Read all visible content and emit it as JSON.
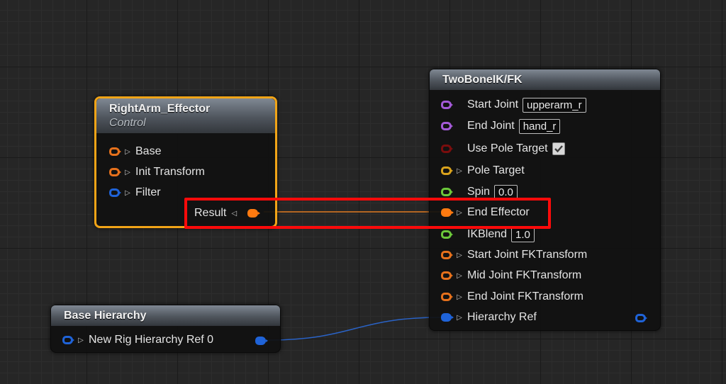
{
  "colors": {
    "accent_selected": "#f1a417",
    "highlight": "#ff0a0a",
    "wire_transform": "#e07a20",
    "wire_hierarchy": "#2a63c7"
  },
  "nodes": {
    "right_arm_effector": {
      "title": "RightArm_Effector",
      "subtitle": "Control",
      "pins": {
        "base": {
          "label": "Base",
          "color": "#e6711c"
        },
        "init_transform": {
          "label": "Init Transform",
          "color": "#e6711c"
        },
        "filter": {
          "label": "Filter",
          "color": "#1f63d8"
        },
        "result": {
          "label": "Result",
          "color": "#ff7a10"
        }
      }
    },
    "base_hierarchy": {
      "title": "Base Hierarchy",
      "pins": {
        "rig_hierarchy_ref": {
          "label": "New Rig Hierarchy Ref 0",
          "color": "#1f63d8"
        }
      }
    },
    "two_bone_ik": {
      "title": "TwoBoneIK/FK",
      "pins": {
        "start_joint": {
          "label": "Start Joint",
          "value": "upperarm_r",
          "color": "#a45ad8"
        },
        "end_joint": {
          "label": "End Joint",
          "value": "hand_r",
          "color": "#a45ad8"
        },
        "use_pole_target": {
          "label": "Use Pole Target",
          "checked": true,
          "color": "#7a0d0d"
        },
        "pole_target": {
          "label": "Pole Target",
          "color": "#d9a21c"
        },
        "spin": {
          "label": "Spin",
          "value": "0.0",
          "color": "#6bc73a"
        },
        "end_effector": {
          "label": "End Effector",
          "color": "#ff7a10"
        },
        "ik_blend": {
          "label": "IKBlend",
          "value": "1.0",
          "color": "#6bc73a"
        },
        "start_joint_fk": {
          "label": "Start Joint FKTransform",
          "color": "#e6711c"
        },
        "mid_joint_fk": {
          "label": "Mid Joint FKTransform",
          "color": "#e6711c"
        },
        "end_joint_fk": {
          "label": "End Joint FKTransform",
          "color": "#e6711c"
        },
        "hierarchy_ref": {
          "label": "Hierarchy Ref",
          "color": "#1f63d8"
        }
      }
    }
  }
}
